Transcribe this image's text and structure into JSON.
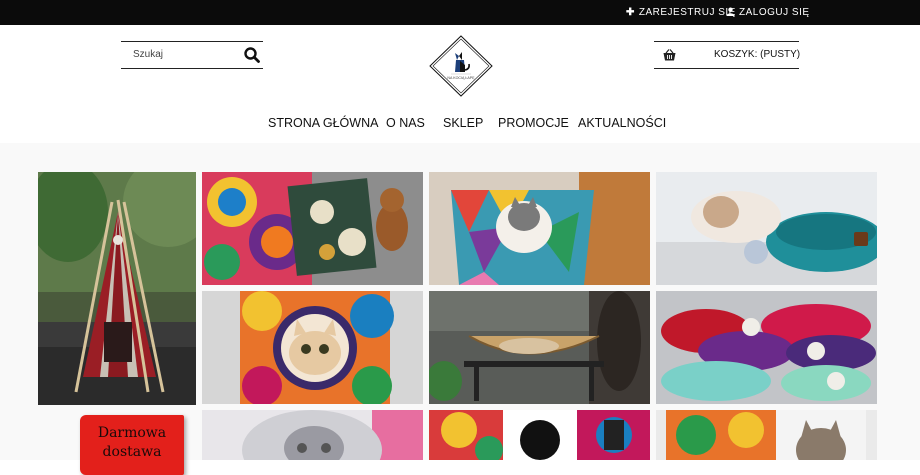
{
  "topbar": {
    "register_label": "Zarejestruj się",
    "login_label": "Zaloguj się",
    "register_icon": "plus-icon",
    "login_icon": "user-icon"
  },
  "header": {
    "search": {
      "placeholder": "Szukaj",
      "value": ""
    },
    "logo_text": "NA KOCIĄ ŁAPĘ",
    "cart_label": "KOSZYK: (PUSTY)"
  },
  "nav": {
    "items": [
      {
        "label": "STRONA GŁÓWNA"
      },
      {
        "label": "O NAS"
      },
      {
        "label": "SKLEP"
      },
      {
        "label": "PROMOCJE"
      },
      {
        "label": "AKTUALNOŚCI"
      }
    ]
  },
  "promo": {
    "line1": "Darmowa",
    "line2": "dostawa"
  },
  "colors": {
    "topbar": "#0b0b0b",
    "promo": "#e3201b",
    "content_bg": "#f9f9f9"
  }
}
